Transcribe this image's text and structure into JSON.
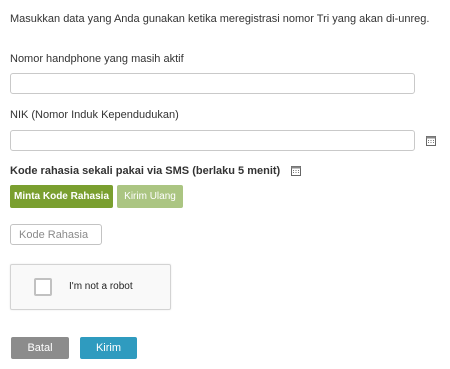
{
  "intro_text": "Masukkan data yang Anda gunakan ketika meregistrasi nomor Tri yang akan di-unreg.",
  "phone": {
    "label": "Nomor handphone yang masih aktif",
    "value": ""
  },
  "nik": {
    "label": "NIK (Nomor Induk Kependudukan)",
    "value": "",
    "icon": "calendar-icon"
  },
  "sms": {
    "title": "Kode rahasia sekali pakai via SMS (berlaku 5 menit)",
    "icon": "info-icon",
    "request_label": "Minta Kode Rahasia",
    "resend_label": "Kirim Ulang",
    "code_placeholder": "Kode Rahasia"
  },
  "captcha": {
    "label": "I'm not a robot",
    "checked": false
  },
  "actions": {
    "cancel_label": "Batal",
    "submit_label": "Kirim"
  },
  "colors": {
    "request_button": "#7a9f2f",
    "resend_button": "#abc582",
    "cancel_button": "#8c8c8c",
    "submit_button": "#2f9bbf"
  }
}
